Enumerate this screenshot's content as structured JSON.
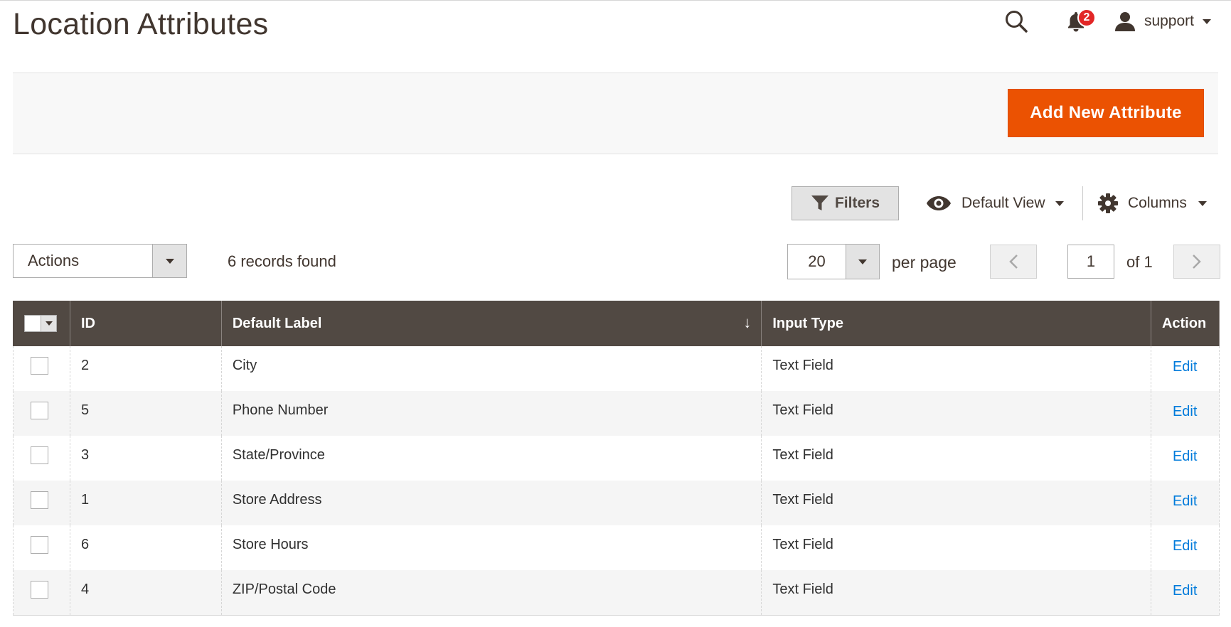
{
  "header": {
    "title": "Location Attributes",
    "notifications_count": "2",
    "user_name": "support"
  },
  "page_actions": {
    "add_button_label": "Add New Attribute"
  },
  "toolbar": {
    "filters_label": "Filters",
    "view_label": "Default View",
    "columns_label": "Columns"
  },
  "mass_actions": {
    "select_value": "Actions",
    "records_found": "6 records found"
  },
  "pagination": {
    "per_page_value": "20",
    "per_page_label": "per page",
    "current_page": "1",
    "of_label": "of 1"
  },
  "grid": {
    "columns": [
      "ID",
      "Default Label",
      "Input Type",
      "Action"
    ],
    "sort_indicator": "↓",
    "rows": [
      {
        "id": "2",
        "label": "City",
        "input_type": "Text Field",
        "action": "Edit"
      },
      {
        "id": "5",
        "label": "Phone Number",
        "input_type": "Text Field",
        "action": "Edit"
      },
      {
        "id": "3",
        "label": "State/Province",
        "input_type": "Text Field",
        "action": "Edit"
      },
      {
        "id": "1",
        "label": "Store Address",
        "input_type": "Text Field",
        "action": "Edit"
      },
      {
        "id": "6",
        "label": "Store Hours",
        "input_type": "Text Field",
        "action": "Edit"
      },
      {
        "id": "4",
        "label": "ZIP/Postal Code",
        "input_type": "Text Field",
        "action": "Edit"
      }
    ]
  },
  "colors": {
    "accent": "#eb5202",
    "header_bg": "#514943",
    "link": "#007bdb",
    "badge": "#e22626"
  }
}
